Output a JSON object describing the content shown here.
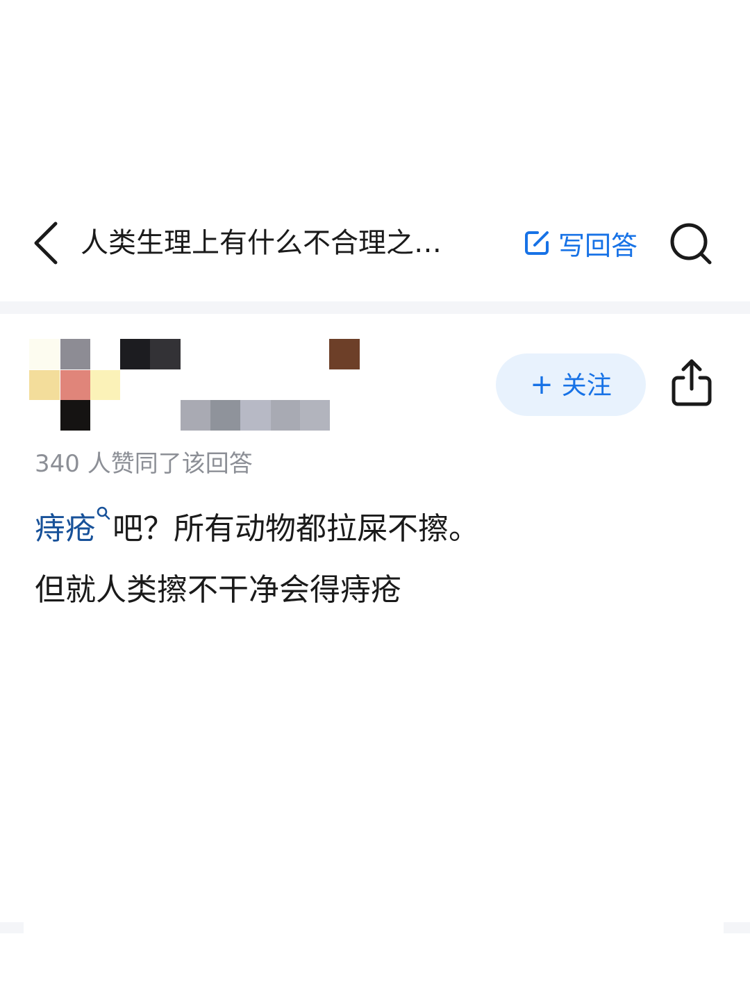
{
  "nav": {
    "back_icon": "chevron-left-icon",
    "title": "人类生理上有什么不合理之…",
    "write_answer_icon": "edit-icon",
    "write_answer_label": "写回答",
    "search_icon": "search-icon"
  },
  "author": {
    "avatar": "pixelated-avatar",
    "follow_plus": "+",
    "follow_label": "关注",
    "share_icon": "share-icon"
  },
  "vote_text": "340 人赞同了该回答",
  "answer": {
    "line1_link": "痔疮",
    "line1_link_icon": "search-small-icon",
    "line1_rest": "吧？所有动物都拉屎不擦。",
    "line2": "但就人类擦不干净会得痔疮"
  },
  "colors": {
    "accent": "#1772e6",
    "link": "#175199",
    "follow_bg": "#e8f2fd",
    "muted_text": "#8c8f96",
    "divider": "#f4f5f8"
  }
}
